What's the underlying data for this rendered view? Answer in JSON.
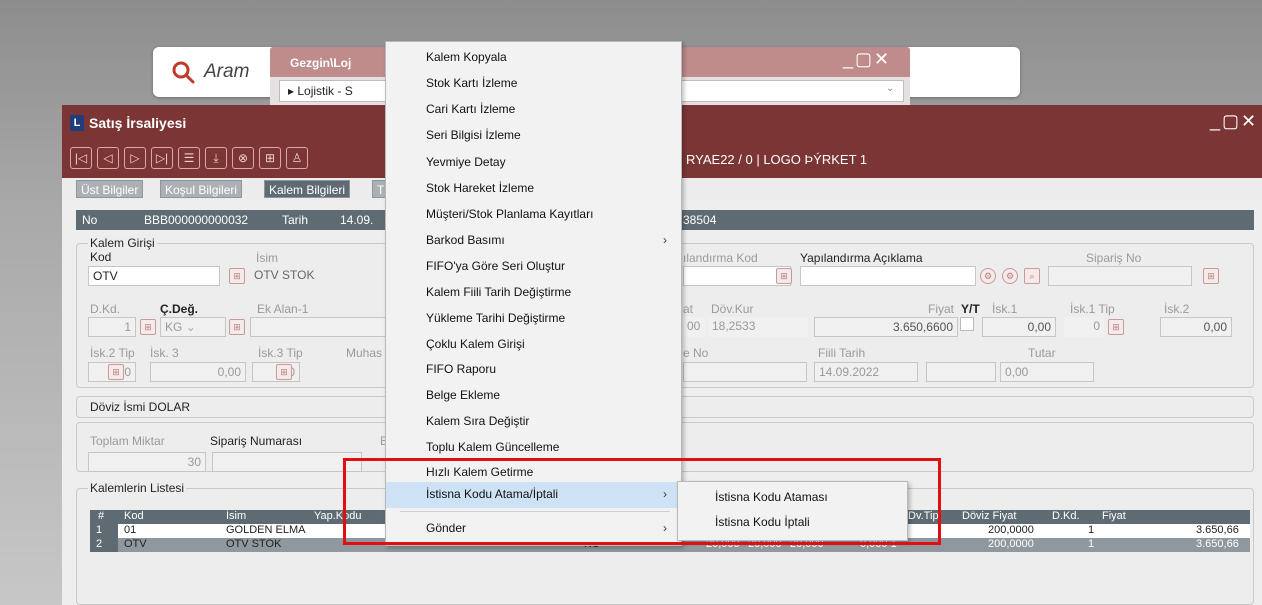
{
  "search": {
    "placeholder": "Aram"
  },
  "gezgin": {
    "title": "Gezgin\\Loj",
    "path": "Lojistik - S"
  },
  "main": {
    "logo": "L",
    "title": "Satış İrsaliyesi",
    "toolbar_info": "RYAE22 / 0 | LOGO ÞÝRKET 1"
  },
  "tabs": [
    "Üst Bilgiler",
    "Koşul Bilgileri",
    "Kalem Bilgileri",
    "T"
  ],
  "info_strip": {
    "no_label": "No",
    "no_value": "BBB000000000032",
    "tarih_label": "Tarih",
    "tarih_value": "14.09.",
    "right_value": "38504"
  },
  "kalem_girisi": {
    "group_label": "Kalem Girişi",
    "kod_label": "Kod",
    "kod_value": "OTV",
    "isim_label": "İsim",
    "isim_value": "OTV STOK",
    "yap_kod_label": "ılandırma Kod",
    "yap_aciklama_label": "Yapılandırma Açıklama",
    "siparis_no_label": "Sipariş No",
    "dkd_label": "D.Kd.",
    "dkd_value": "1",
    "cdeg_label": "Ç.Değ.",
    "cdeg_value": "KG",
    "ek_alan_label": "Ek Alan-1",
    "fiyat_label_partial": "at",
    "fiyat_value_partial": "00",
    "dov_kur_label": "Döv.Kur",
    "dov_kur_value": "18,2533",
    "fiyat_label": "Fiyat",
    "yt_label": "Y/T",
    "fiyat_value": "3.650,6600",
    "isk1_label": "İsk.1",
    "isk1_value": "0,00",
    "isk1_tip_label": "İsk.1 Tip",
    "isk1_tip_value": "0",
    "isk2_label": "İsk.2",
    "isk2_value": "0,00",
    "isk2_tip_label": "İsk.2 Tip",
    "isk2_tip_value": "0",
    "isk3_label": "İsk. 3",
    "isk3_value": "0,00",
    "isk3_tip_label": "İsk.3 Tip",
    "isk3_tip_value": "0",
    "muhas_label": "Muhas",
    "e_no_label": "e No",
    "fiili_tarih_label": "Fiili Tarih",
    "fiili_tarih_value": "14.09.2022",
    "tutar_label": "Tutar",
    "tutar_value": "0,00"
  },
  "doviz": {
    "label": "Döviz İsmi DOLAR"
  },
  "toplam": {
    "miktar_label": "Toplam Miktar",
    "miktar_value": "30",
    "siparis_label": "Sipariş Numarası",
    "e_label": "E"
  },
  "kalemler": {
    "group_label": "Kalemlerin Listesi",
    "headers": [
      "#",
      "Kod",
      "İsim",
      "Yap.Kodu",
      "Dv.Tip",
      "Döviz Fiyat",
      "D.Kd.",
      "Fiyat"
    ],
    "rows": [
      {
        "num": "1",
        "kod": "01",
        "isim": "GOLDEN ELMA",
        "birim": "",
        "q1": "",
        "q2": "",
        "q3": "",
        "q4": "",
        "doviz_fiyat": "200,0000",
        "dkd": "1",
        "fiyat": "3.650,66"
      },
      {
        "num": "2",
        "kod": "OTV",
        "isim": "OTV STOK",
        "birim": "KG",
        "q1": "20,000",
        "q2": "20,000",
        "q3": "20,000",
        "q4": "0,000 1",
        "doviz_fiyat": "200,0000",
        "dkd": "1",
        "fiyat": "3.650,66"
      }
    ]
  },
  "context_menu": [
    {
      "label": "Kalem Kopyala"
    },
    {
      "label": "Stok Kartı İzleme"
    },
    {
      "label": "Cari Kartı İzleme"
    },
    {
      "label": "Seri Bilgisi İzleme"
    },
    {
      "label": "Yevmiye Detay"
    },
    {
      "label": "Stok Hareket İzleme"
    },
    {
      "label": "Müşteri/Stok Planlama Kayıtları"
    },
    {
      "label": "Barkod Basımı",
      "submenu": true
    },
    {
      "label": "FIFO'ya Göre Seri Oluştur"
    },
    {
      "label": "Kalem Fiili Tarih Değiştirme"
    },
    {
      "label": "Yükleme Tarihi Değiştirme"
    },
    {
      "label": "Çoklu Kalem Girişi"
    },
    {
      "label": "FIFO Raporu"
    },
    {
      "label": "Belge Ekleme"
    },
    {
      "label": "Kalem Sıra Değiştir"
    },
    {
      "label": "Toplu Kalem Güncelleme"
    },
    {
      "label": "Hızlı Kalem Getirme"
    },
    {
      "label": "İstisna Kodu Atama/İptali",
      "submenu": true,
      "highlighted": true
    },
    {
      "label": "Gönder",
      "submenu": true
    }
  ],
  "submenu": [
    {
      "label": "İstisna Kodu Ataması"
    },
    {
      "label": "İstisna Kodu İptali"
    }
  ],
  "colors": {
    "title_bar": "#7c3535",
    "gezgin_title": "#bf8b8b",
    "grid_header": "#5f6b73",
    "menu_highlight": "#cde3f5",
    "annotation_box": "#e01010"
  }
}
